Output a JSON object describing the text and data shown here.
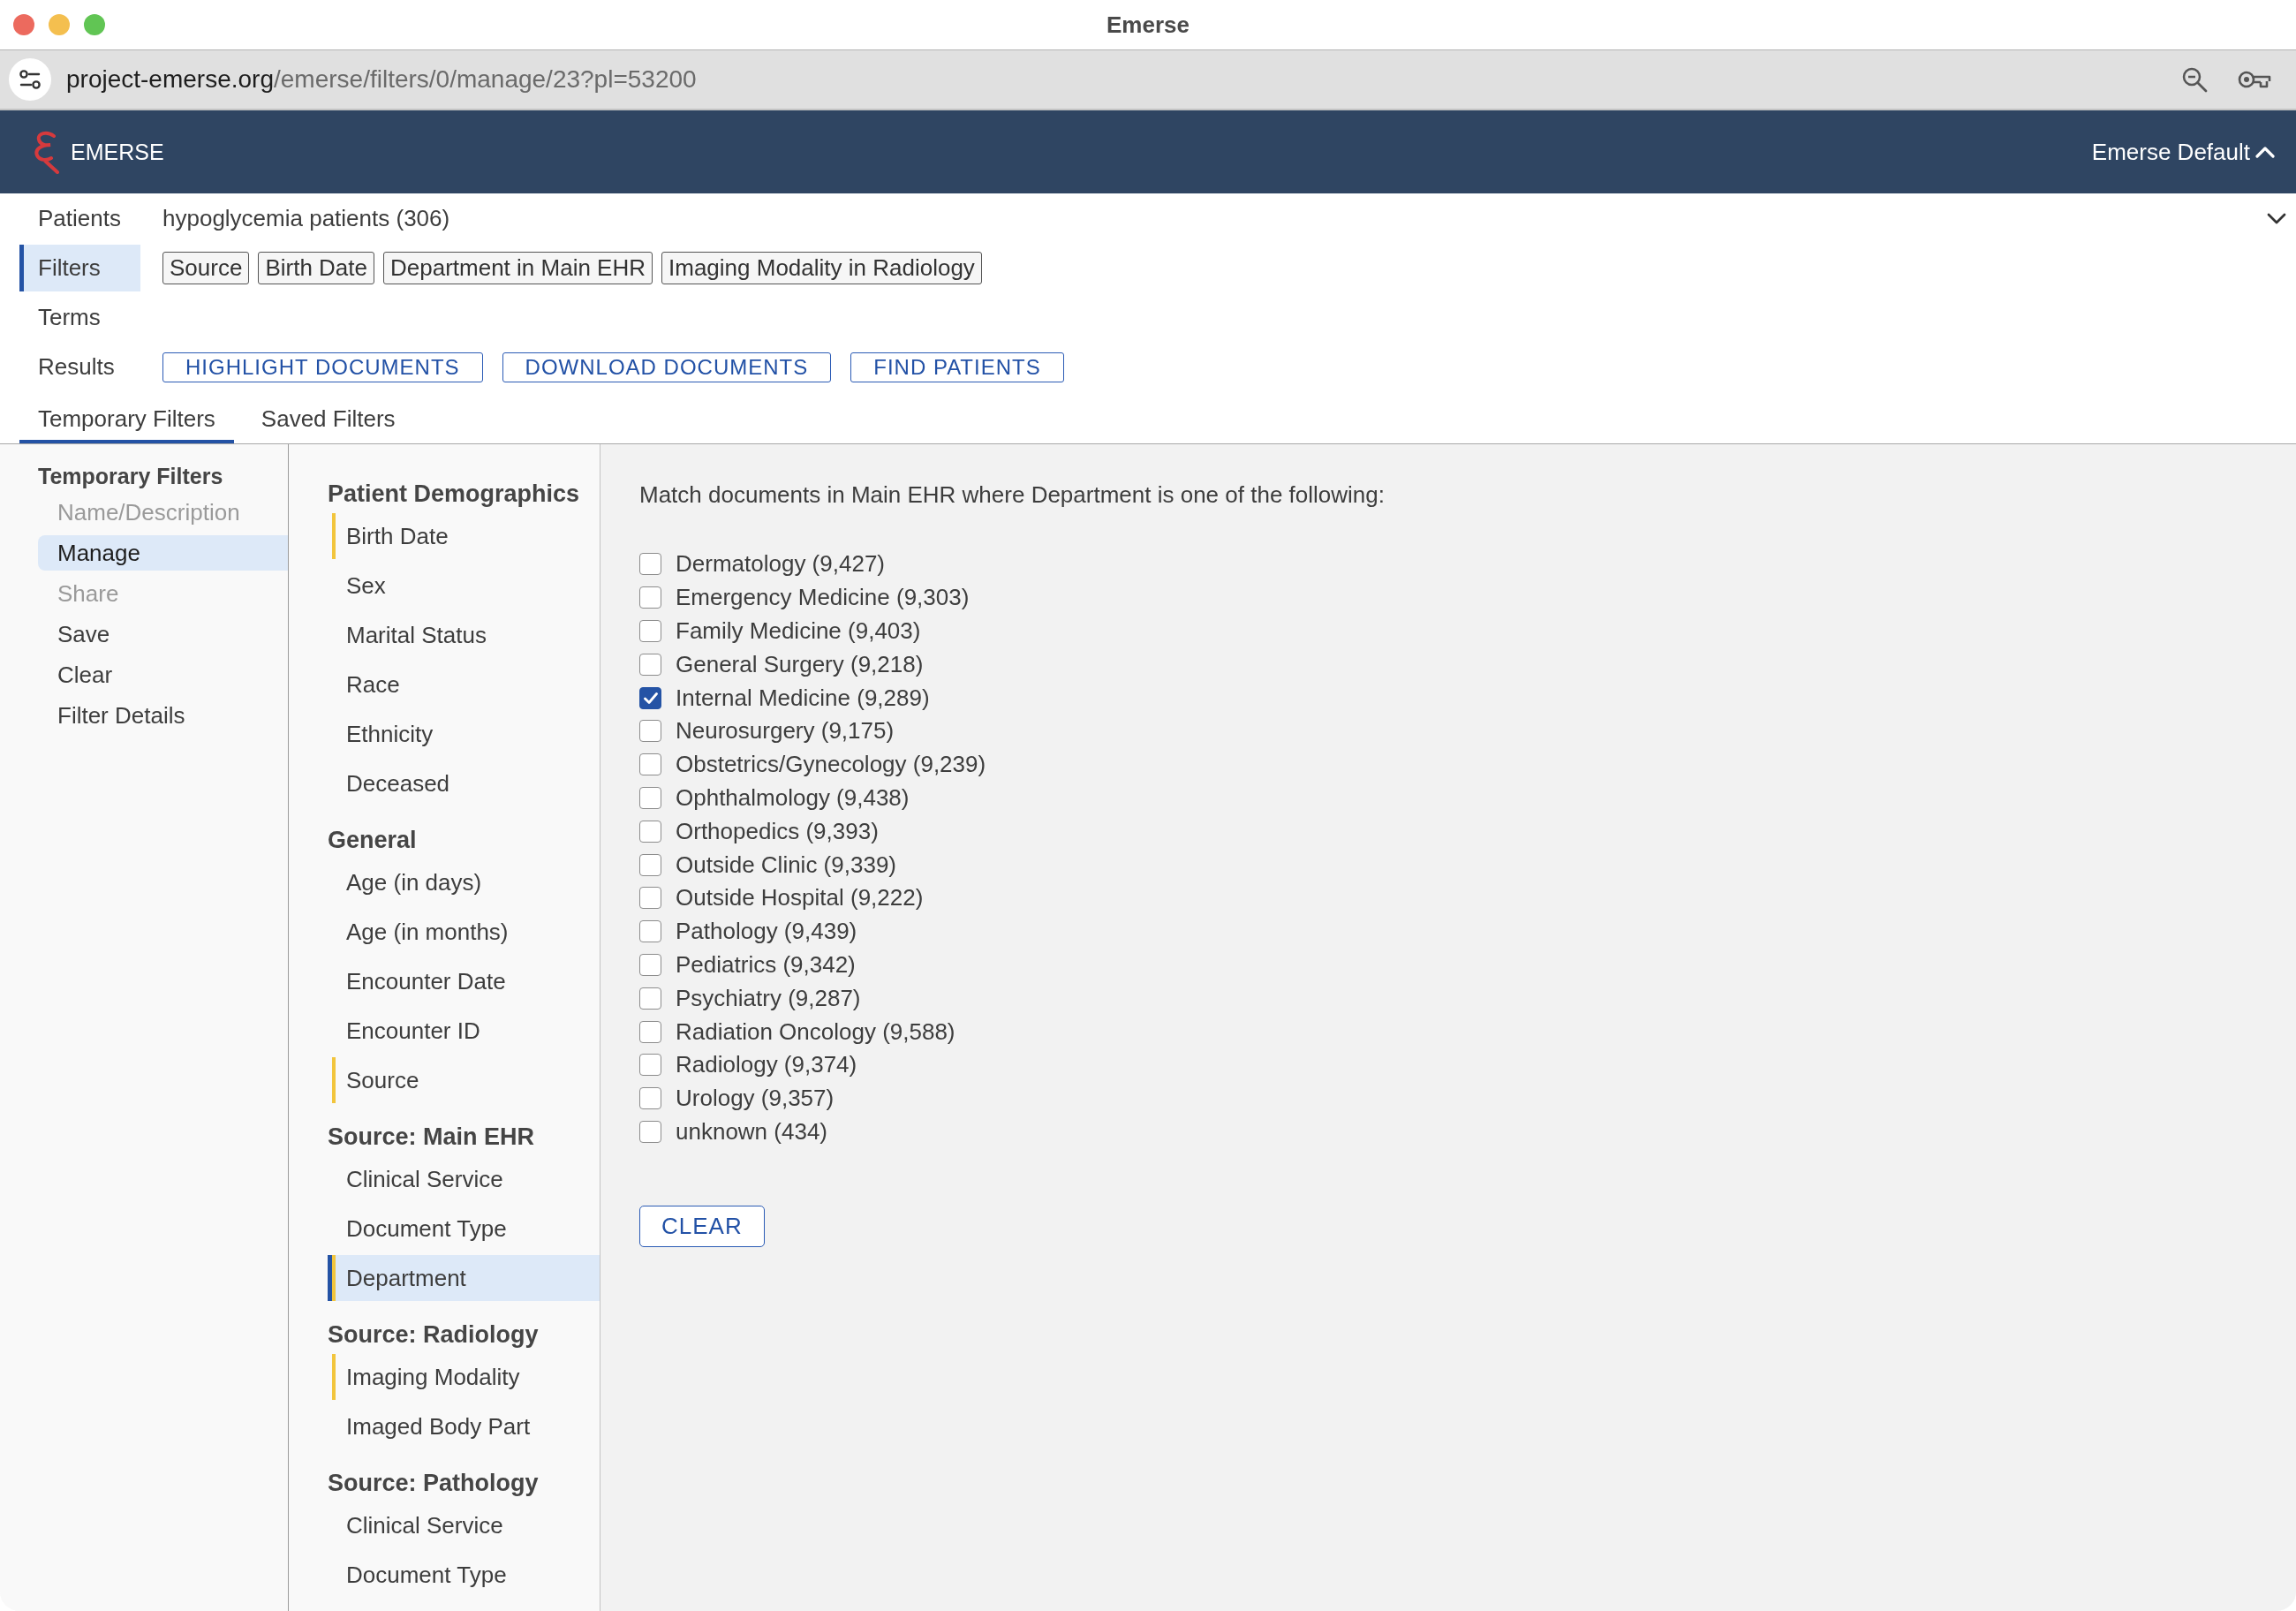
{
  "window": {
    "title": "Emerse"
  },
  "address_bar": {
    "domain": "project-emerse.org",
    "path": "/emerse/filters/0/manage/23?pl=53200"
  },
  "app_header": {
    "brand": "EMERSE",
    "profile_menu": "Emerse Default"
  },
  "summary": {
    "rows": [
      {
        "kind": "text",
        "label": "Patients",
        "selected": false,
        "value": "hypoglycemia patients (306)"
      },
      {
        "kind": "chips",
        "label": "Filters",
        "selected": true,
        "chips": [
          "Source",
          "Birth Date",
          "Department in Main EHR",
          "Imaging Modality in Radiology"
        ]
      },
      {
        "kind": "empty",
        "label": "Terms",
        "selected": false
      },
      {
        "kind": "buttons",
        "label": "Results",
        "selected": false,
        "buttons": [
          "HIGHLIGHT DOCUMENTS",
          "DOWNLOAD DOCUMENTS",
          "FIND PATIENTS"
        ]
      }
    ]
  },
  "tabs": [
    {
      "label": "Temporary Filters",
      "selected": true
    },
    {
      "label": "Saved Filters",
      "selected": false
    }
  ],
  "side_menu": {
    "title": "Temporary Filters",
    "items": [
      {
        "label": "Name/Description",
        "selected": false,
        "disabled": true
      },
      {
        "label": "Manage",
        "selected": true,
        "disabled": false
      },
      {
        "label": "Share",
        "selected": false,
        "disabled": true
      },
      {
        "label": "Save",
        "selected": false,
        "disabled": false
      },
      {
        "label": "Clear",
        "selected": false,
        "disabled": false
      },
      {
        "label": "Filter Details",
        "selected": false,
        "disabled": false
      }
    ]
  },
  "filter_groups": [
    {
      "heading": "Patient Demographics",
      "items": [
        {
          "label": "Birth Date",
          "has_filter": true,
          "selected": false
        },
        {
          "label": "Sex",
          "has_filter": false,
          "selected": false
        },
        {
          "label": "Marital Status",
          "has_filter": false,
          "selected": false
        },
        {
          "label": "Race",
          "has_filter": false,
          "selected": false
        },
        {
          "label": "Ethnicity",
          "has_filter": false,
          "selected": false
        },
        {
          "label": "Deceased",
          "has_filter": false,
          "selected": false
        }
      ]
    },
    {
      "heading": "General",
      "items": [
        {
          "label": "Age (in days)",
          "has_filter": false,
          "selected": false
        },
        {
          "label": "Age (in months)",
          "has_filter": false,
          "selected": false
        },
        {
          "label": "Encounter Date",
          "has_filter": false,
          "selected": false
        },
        {
          "label": "Encounter ID",
          "has_filter": false,
          "selected": false
        },
        {
          "label": "Source",
          "has_filter": true,
          "selected": false
        }
      ]
    },
    {
      "heading": "Source: Main EHR",
      "items": [
        {
          "label": "Clinical Service",
          "has_filter": false,
          "selected": false
        },
        {
          "label": "Document Type",
          "has_filter": false,
          "selected": false
        },
        {
          "label": "Department",
          "has_filter": true,
          "selected": true
        }
      ]
    },
    {
      "heading": "Source: Radiology",
      "items": [
        {
          "label": "Imaging Modality",
          "has_filter": true,
          "selected": false
        },
        {
          "label": "Imaged Body Part",
          "has_filter": false,
          "selected": false
        }
      ]
    },
    {
      "heading": "Source: Pathology",
      "items": [
        {
          "label": "Clinical Service",
          "has_filter": false,
          "selected": false
        },
        {
          "label": "Document Type",
          "has_filter": false,
          "selected": false
        }
      ]
    }
  ],
  "filter_panel": {
    "description": "Match documents in Main EHR where Department is one of the following:",
    "options": [
      {
        "label": "Dermatology (9,427)",
        "checked": false
      },
      {
        "label": "Emergency Medicine (9,303)",
        "checked": false
      },
      {
        "label": "Family Medicine (9,403)",
        "checked": false
      },
      {
        "label": "General Surgery (9,218)",
        "checked": false
      },
      {
        "label": "Internal Medicine (9,289)",
        "checked": true
      },
      {
        "label": "Neurosurgery (9,175)",
        "checked": false
      },
      {
        "label": "Obstetrics/Gynecology (9,239)",
        "checked": false
      },
      {
        "label": "Ophthalmology (9,438)",
        "checked": false
      },
      {
        "label": "Orthopedics (9,393)",
        "checked": false
      },
      {
        "label": "Outside Clinic (9,339)",
        "checked": false
      },
      {
        "label": "Outside Hospital (9,222)",
        "checked": false
      },
      {
        "label": "Pathology (9,439)",
        "checked": false
      },
      {
        "label": "Pediatrics (9,342)",
        "checked": false
      },
      {
        "label": "Psychiatry (9,287)",
        "checked": false
      },
      {
        "label": "Radiation Oncology (9,588)",
        "checked": false
      },
      {
        "label": "Radiology (9,374)",
        "checked": false
      },
      {
        "label": "Urology (9,357)",
        "checked": false
      },
      {
        "label": "unknown (434)",
        "checked": false
      }
    ],
    "clear_button": "CLEAR"
  }
}
